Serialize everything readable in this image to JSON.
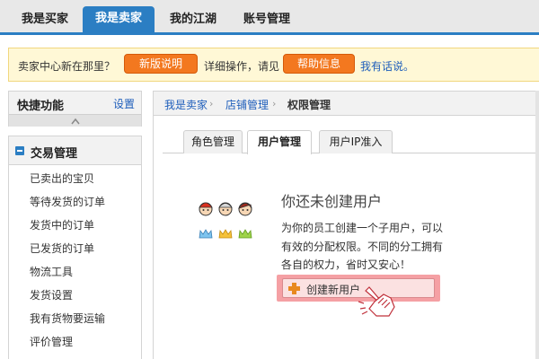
{
  "topnav": {
    "tabs": [
      {
        "label": "我是买家"
      },
      {
        "label": "我是卖家"
      },
      {
        "label": "我的江湖"
      },
      {
        "label": "账号管理"
      }
    ]
  },
  "notice": {
    "text1": "卖家中心新在那里？",
    "btn1": "新版说明",
    "text2": "详细操作，请见",
    "btn2": "帮助信息",
    "link": "我有话说。"
  },
  "sidebar": {
    "quick_title": "快捷功能",
    "quick_setting": "设置",
    "trade_title": "交易管理",
    "items": [
      {
        "label": "已卖出的宝贝"
      },
      {
        "label": "等待发货的订单"
      },
      {
        "label": "发货中的订单"
      },
      {
        "label": "已发货的订单"
      },
      {
        "label": "物流工具"
      },
      {
        "label": "发货设置"
      },
      {
        "label": "我有货物要运输"
      },
      {
        "label": "评价管理"
      }
    ]
  },
  "breadcrumb": {
    "item1": "我是卖家",
    "item2": "店铺管理",
    "item3": "权限管理",
    "sep": "›"
  },
  "tabs": [
    {
      "label": "角色管理"
    },
    {
      "label": "用户管理"
    },
    {
      "label": "用户IP准入"
    }
  ],
  "empty": {
    "title": "你还未创建用户",
    "line1": "为你的员工创建一个子用户，可以",
    "line2": "有效的分配权限。不同的分工拥有",
    "line3": "各自的权力，省时又安心！",
    "button": "创建新用户"
  },
  "colors": {
    "accent": "#2b7ec3",
    "orange": "#f3781f",
    "link": "#1e5ebb"
  }
}
